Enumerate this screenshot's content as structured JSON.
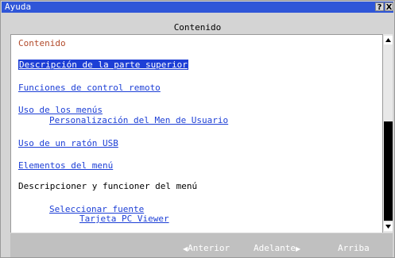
{
  "window": {
    "title": "Ayuda",
    "help_glyph": "?",
    "close_glyph": "X"
  },
  "header": {
    "title": "Contenido"
  },
  "content": {
    "title": "Contenido",
    "items": [
      {
        "label": "Descripción de la parte superior",
        "type": "link",
        "selected": true
      },
      {
        "label": "Funciones de control remoto",
        "type": "link"
      },
      {
        "label": "Uso de los menús",
        "type": "link"
      },
      {
        "label": "Personalización del Men de Usuario",
        "type": "link"
      },
      {
        "label": "Uso de un ratón USB",
        "type": "link"
      },
      {
        "label": "Elementos del menú",
        "type": "link"
      },
      {
        "label": "Descripcioner y funcioner del menú",
        "type": "text"
      },
      {
        "label": "Seleccionar fuente",
        "type": "link"
      },
      {
        "label": "Tarjeta PC Viewer",
        "type": "link"
      }
    ]
  },
  "footer": {
    "prev_label": "Anterior",
    "next_label": "Adelante",
    "up_label": "Arriba",
    "prev_icon": "left-triangle-icon",
    "next_icon": "right-triangle-icon"
  },
  "colors": {
    "titlebar": "#2f56d8",
    "link": "#1d3fd6",
    "content_title": "#b24a2a",
    "selection": "#1d3fd6"
  }
}
